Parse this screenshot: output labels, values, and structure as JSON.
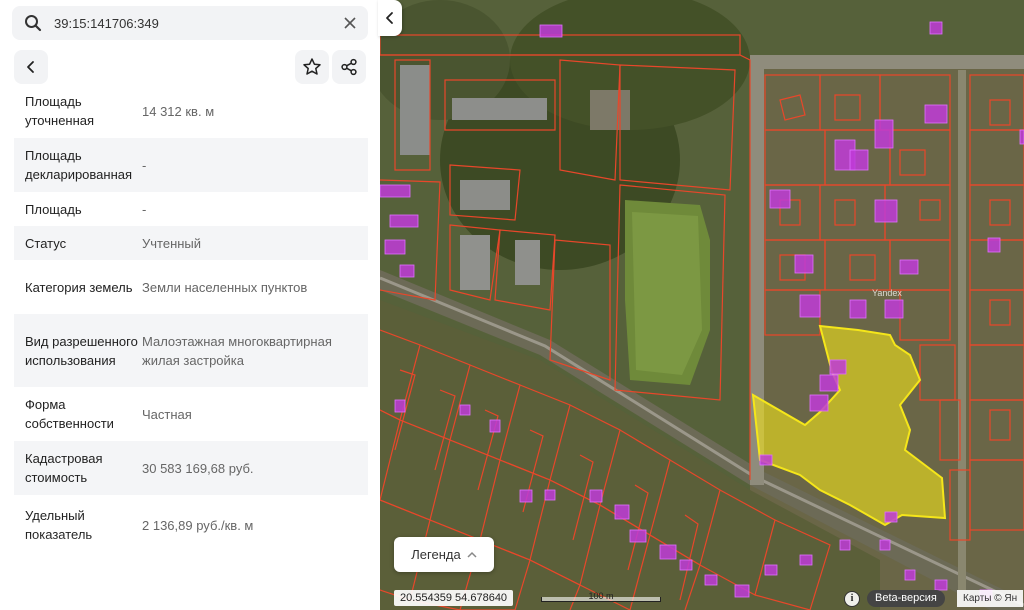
{
  "search": {
    "value": "39:15:141706:349",
    "icon": "search-icon",
    "clear_icon": "close-icon"
  },
  "toolbar": {
    "back_icon": "chevron-left-icon",
    "favorite_icon": "star-icon",
    "share_icon": "share-icon"
  },
  "properties": [
    {
      "key": "Площадь уточненная",
      "value": "14 312 кв. м"
    },
    {
      "key": "Площадь декларированная",
      "value": "-"
    },
    {
      "key": "Площадь",
      "value": "-"
    },
    {
      "key": "Статус",
      "value": "Учтенный"
    },
    {
      "key": "Категория земель",
      "value": "Земли населенных пунктов"
    },
    {
      "key": "Вид разрешенного использования",
      "value": "Малоэтажная многоквартирная жилая застройка"
    },
    {
      "key": "Форма собственности",
      "value": "Частная"
    },
    {
      "key": "Кадастровая стоимость",
      "value": "30 583 169,68 руб."
    },
    {
      "key": "Удельный показатель",
      "value": "2 136,89 руб./кв. м"
    }
  ],
  "map": {
    "collapse_icon": "chevron-left-icon",
    "legend_label": "Легенда",
    "legend_icon": "chevron-up-icon",
    "coordinates": "20.554359  54.678640",
    "scale_label": "100 m",
    "beta_label": "Beta-версия",
    "copyright": "Карты © Ян",
    "watermark": "Yandex",
    "colors": {
      "parcel_border": "#e8472a",
      "selected_fill": "#f2e21a",
      "building_fill": "#c03bd8"
    }
  }
}
